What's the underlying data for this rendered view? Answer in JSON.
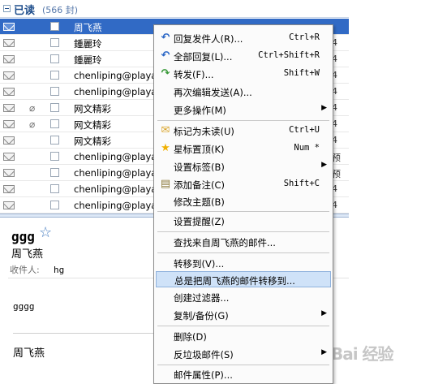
{
  "group": {
    "title": "已读",
    "count": "(566 封)"
  },
  "mail_rows": [
    {
      "sender": "周飞燕",
      "attachment": false,
      "tail": "",
      "selected": true
    },
    {
      "sender": "鍾麗玲",
      "attachment": false,
      "tail": "4",
      "selected": false
    },
    {
      "sender": "鍾麗玲",
      "attachment": false,
      "tail": "4",
      "selected": false
    },
    {
      "sender": "chenliping@playa",
      "attachment": false,
      "tail": "4",
      "selected": false
    },
    {
      "sender": "chenliping@playa",
      "attachment": false,
      "tail": "4",
      "selected": false
    },
    {
      "sender": "网文精彩",
      "attachment": true,
      "tail": "4",
      "selected": false
    },
    {
      "sender": "网文精彩",
      "attachment": true,
      "tail": "4",
      "selected": false
    },
    {
      "sender": "网文精彩",
      "attachment": false,
      "tail": "4",
      "selected": false
    },
    {
      "sender": "chenliping@playa",
      "attachment": false,
      "tail": "预",
      "selected": false
    },
    {
      "sender": "chenliping@playa",
      "attachment": false,
      "tail": "预",
      "selected": false
    },
    {
      "sender": "chenliping@playa",
      "attachment": false,
      "tail": "4",
      "selected": false
    },
    {
      "sender": "chenliping@playa",
      "attachment": false,
      "tail": "4",
      "selected": false
    }
  ],
  "reading_pane": {
    "subject": "ggg",
    "from": "周飞燕",
    "to_label": "收件人:",
    "to_value": "hg",
    "body": "gggg",
    "signature": "周飞燕"
  },
  "context_menu": {
    "reply": {
      "label": "回复发件人(R)...",
      "shortcut": "Ctrl+R"
    },
    "reply_all": {
      "label": "全部回复(L)...",
      "shortcut": "Ctrl+Shift+R"
    },
    "forward": {
      "label": "转发(F)...",
      "shortcut": "Shift+W"
    },
    "edit_resend": {
      "label": "再次编辑发送(A)..."
    },
    "more_actions": {
      "label": "更多操作(M)"
    },
    "mark_unread": {
      "label": "标记为未读(U)",
      "shortcut": "Ctrl+U"
    },
    "star_top": {
      "label": "星标置顶(K)",
      "shortcut": "Num *"
    },
    "set_tag": {
      "label": "设置标签(B)"
    },
    "add_note": {
      "label": "添加备注(C)",
      "shortcut": "Shift+C"
    },
    "edit_subject": {
      "label": "修改主题(B)"
    },
    "set_reminder": {
      "label": "设置提醒(Z)"
    },
    "find_from": {
      "label": "查找来自周飞燕的邮件..."
    },
    "move_to": {
      "label": "转移到(V)..."
    },
    "always_move": {
      "label": "总是把周飞燕的邮件转移到..."
    },
    "create_filter": {
      "label": "创建过滤器..."
    },
    "copy_backup": {
      "label": "复制/备份(G)"
    },
    "delete": {
      "label": "删除(D)"
    },
    "anti_spam": {
      "label": "反垃圾邮件(S)"
    },
    "properties": {
      "label": "邮件属性(P)..."
    }
  },
  "watermark": "Bai 经验"
}
